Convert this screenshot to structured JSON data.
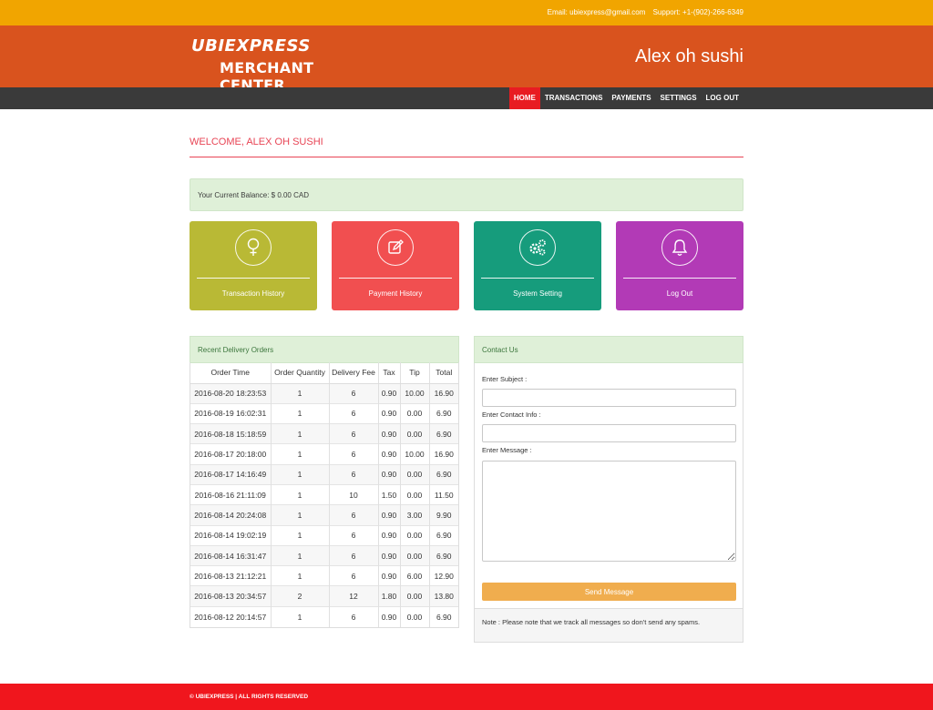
{
  "topbar": {
    "email": "Email: ubiexpress@gmail.com",
    "support": "Support: +1-(902)-266-6349"
  },
  "header": {
    "logo_line1": "UBIEXPRESS",
    "logo_line2": "MERCHANT CENTER",
    "merchant_name": "Alex oh sushi"
  },
  "nav": {
    "items": [
      "HOME",
      "TRANSACTIONS",
      "PAYMENTS",
      "SETTINGS",
      "LOG OUT"
    ],
    "active": "HOME"
  },
  "welcome": "WELCOME, ALEX OH SUSHI",
  "balance": "Your Current Balance: $ 0.00 CAD",
  "tiles": [
    {
      "label": "Transaction History",
      "icon": "female-icon",
      "color": "#b9b935"
    },
    {
      "label": "Payment History",
      "icon": "edit-icon",
      "color": "#f14f50"
    },
    {
      "label": "System Setting",
      "icon": "gears-icon",
      "color": "#169c7c"
    },
    {
      "label": "Log Out",
      "icon": "bell-icon",
      "color": "#b23ab6"
    }
  ],
  "orders": {
    "title": "Recent Delivery Orders",
    "columns": [
      "Order Time",
      "Order Quantity",
      "Delivery Fee",
      "Tax",
      "Tip",
      "Total"
    ],
    "rows": [
      [
        "2016-08-20 18:23:53",
        "1",
        "6",
        "0.90",
        "10.00",
        "16.90"
      ],
      [
        "2016-08-19 16:02:31",
        "1",
        "6",
        "0.90",
        "0.00",
        "6.90"
      ],
      [
        "2016-08-18 15:18:59",
        "1",
        "6",
        "0.90",
        "0.00",
        "6.90"
      ],
      [
        "2016-08-17 20:18:00",
        "1",
        "6",
        "0.90",
        "10.00",
        "16.90"
      ],
      [
        "2016-08-17 14:16:49",
        "1",
        "6",
        "0.90",
        "0.00",
        "6.90"
      ],
      [
        "2016-08-16 21:11:09",
        "1",
        "10",
        "1.50",
        "0.00",
        "11.50"
      ],
      [
        "2016-08-14 20:24:08",
        "1",
        "6",
        "0.90",
        "3.00",
        "9.90"
      ],
      [
        "2016-08-14 19:02:19",
        "1",
        "6",
        "0.90",
        "0.00",
        "6.90"
      ],
      [
        "2016-08-14 16:31:47",
        "1",
        "6",
        "0.90",
        "0.00",
        "6.90"
      ],
      [
        "2016-08-13 21:12:21",
        "1",
        "6",
        "0.90",
        "6.00",
        "12.90"
      ],
      [
        "2016-08-13 20:34:57",
        "2",
        "12",
        "1.80",
        "0.00",
        "13.80"
      ],
      [
        "2016-08-12 20:14:57",
        "1",
        "6",
        "0.90",
        "0.00",
        "6.90"
      ]
    ]
  },
  "contact": {
    "title": "Contact Us",
    "subject_label": "Enter Subject :",
    "subject_value": "",
    "info_label": "Enter Contact Info :",
    "info_value": "",
    "message_label": "Enter Message :",
    "message_value": "",
    "send_label": "Send Message",
    "note": "Note : Please note that we track all messages so don't send any spams."
  },
  "footer": {
    "copyright": "© UBIEXPRESS | ALL RIGHTS RESERVED"
  },
  "colors": {
    "topbar": "#f1a500",
    "header": "#d9531e",
    "nav": "#3a3a3a",
    "nav_active": "#e81c22",
    "accent": "#e84555",
    "send_button": "#f0ad4e",
    "footer": "#f0161d"
  }
}
